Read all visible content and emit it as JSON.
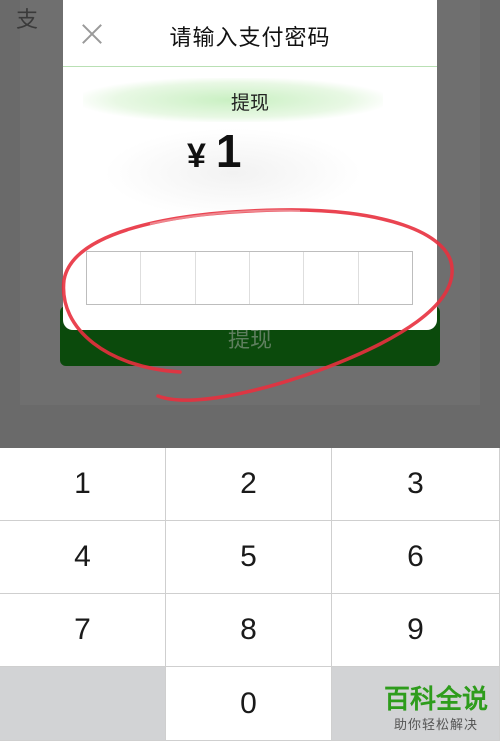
{
  "background": {
    "header_fragment": "支",
    "submit_button_label": "提现",
    "button_color": "#0b4a0c"
  },
  "dialog": {
    "close_icon": "close-icon",
    "title": "请输入支付密码",
    "subtitle": "提现",
    "currency": "¥",
    "amount": "1",
    "password_digits": 6,
    "password_filled": 0
  },
  "keyboard": {
    "keys": [
      "1",
      "2",
      "3",
      "4",
      "5",
      "6",
      "7",
      "8",
      "9",
      "",
      "0",
      ""
    ]
  },
  "annotation": {
    "color": "#e8303e",
    "shape": "hand-drawn circle around password field"
  },
  "watermark": {
    "title": "百科全说",
    "subtitle": "助你轻松解决",
    "color": "#2e9c1c"
  }
}
